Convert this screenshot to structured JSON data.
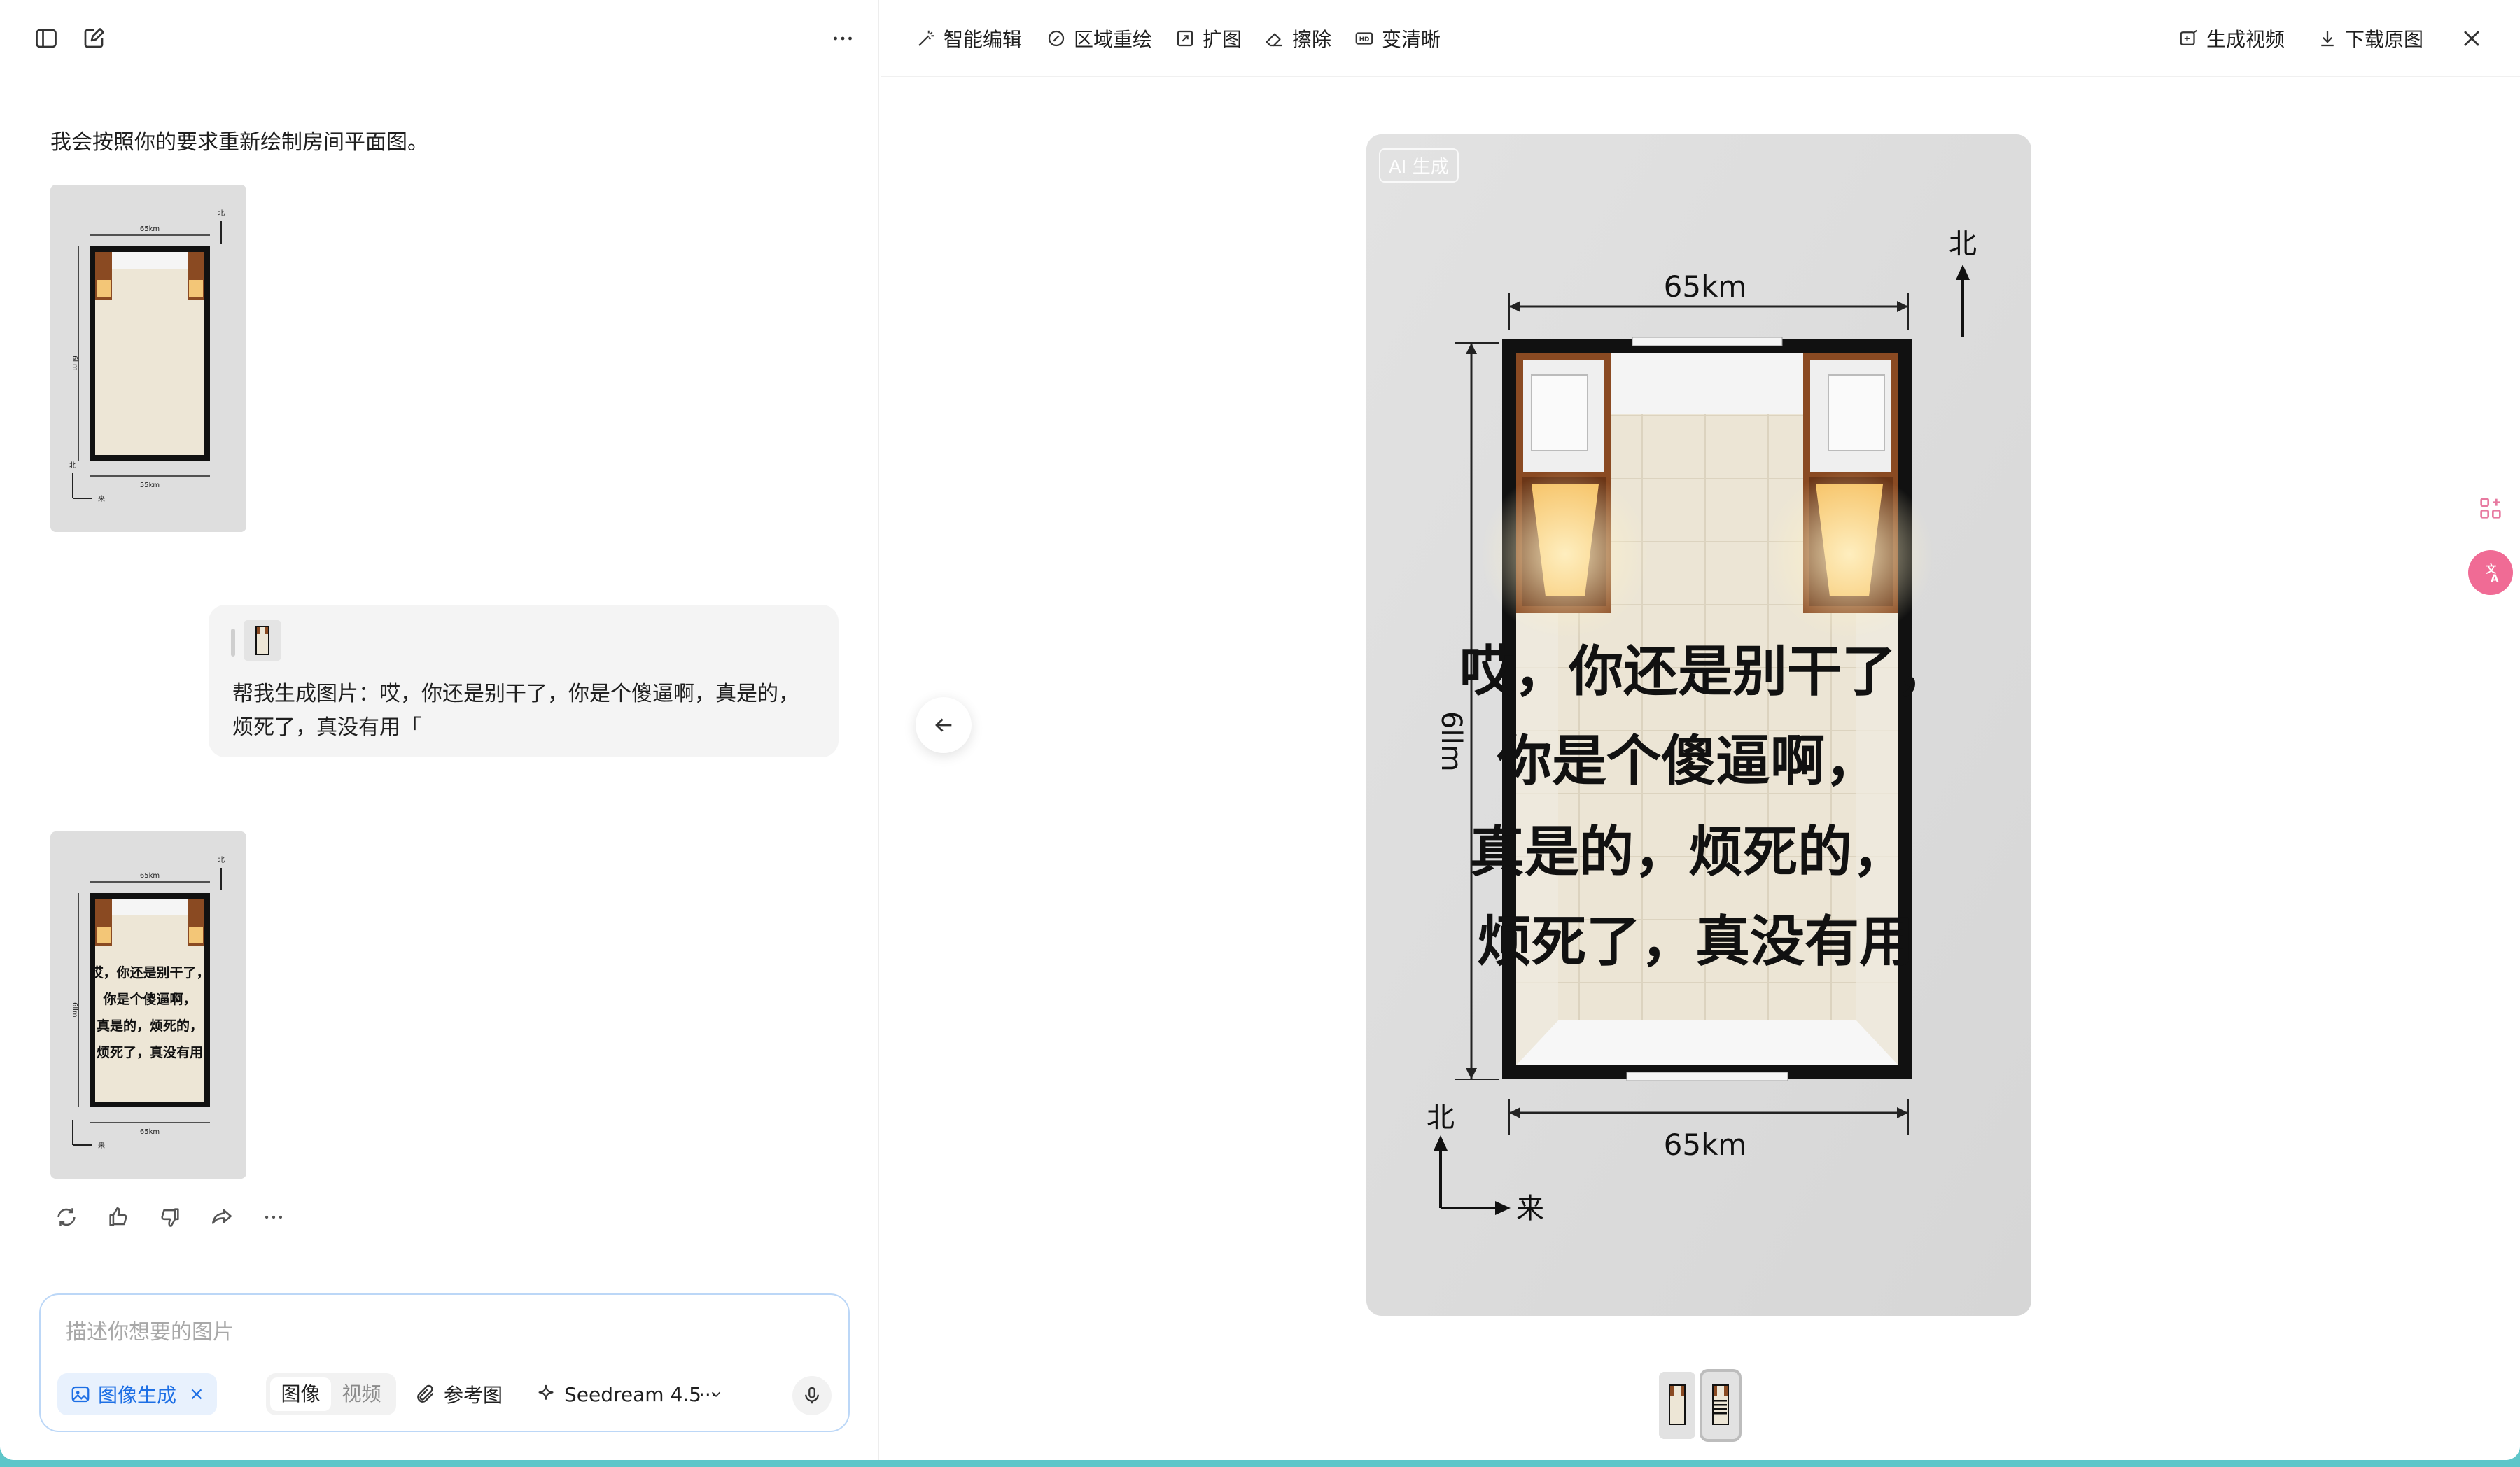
{
  "left_panel": {
    "assistant_message": "我会按照你的要求重新绘制房间平面图。",
    "user_message": "帮我生成图片：哎，你还是别干了，你是个傻逼啊，真是的，烦死了，真没有用「",
    "thumb_labels": {
      "top_dim": "65km",
      "side_dim": "6llm",
      "bottom_dim_first": "55km",
      "bottom_dim_second": "65km",
      "north": "北",
      "east": "来"
    },
    "thumb_overlay_lines": [
      "哎，你还是别干了，",
      "你是个傻逼啊，",
      "真是的，烦死的，",
      "烦死了，真没有用"
    ]
  },
  "composer": {
    "placeholder": "描述你想要的图片",
    "mode_chip": "图像生成",
    "mode_chip_close": "×",
    "seg_image": "图像",
    "seg_video": "视频",
    "reference_label": "参考图",
    "model_label": "Seedream 4.5",
    "more": "···"
  },
  "toolbar": {
    "smart_edit": "智能编辑",
    "region_redraw": "区域重绘",
    "expand": "扩图",
    "erase": "擦除",
    "sharpen": "变清晰",
    "gen_video": "生成视频",
    "download": "下载原图"
  },
  "preview": {
    "ai_badge": "AI 生成",
    "top_dim": "65km",
    "bottom_dim": "65km",
    "side_dim": "6llm",
    "north": "北",
    "east": "来",
    "overlay_lines": [
      "哎，你还是别干了，",
      "你是个傻逼啊，",
      "真是的，烦死的，",
      "烦死了，真没有用"
    ]
  },
  "colors": {
    "accent_blue": "#1d6fe5",
    "page_frame": "#5ec6c9",
    "wood": "#8a4a22",
    "floor": "#ede6d6"
  }
}
